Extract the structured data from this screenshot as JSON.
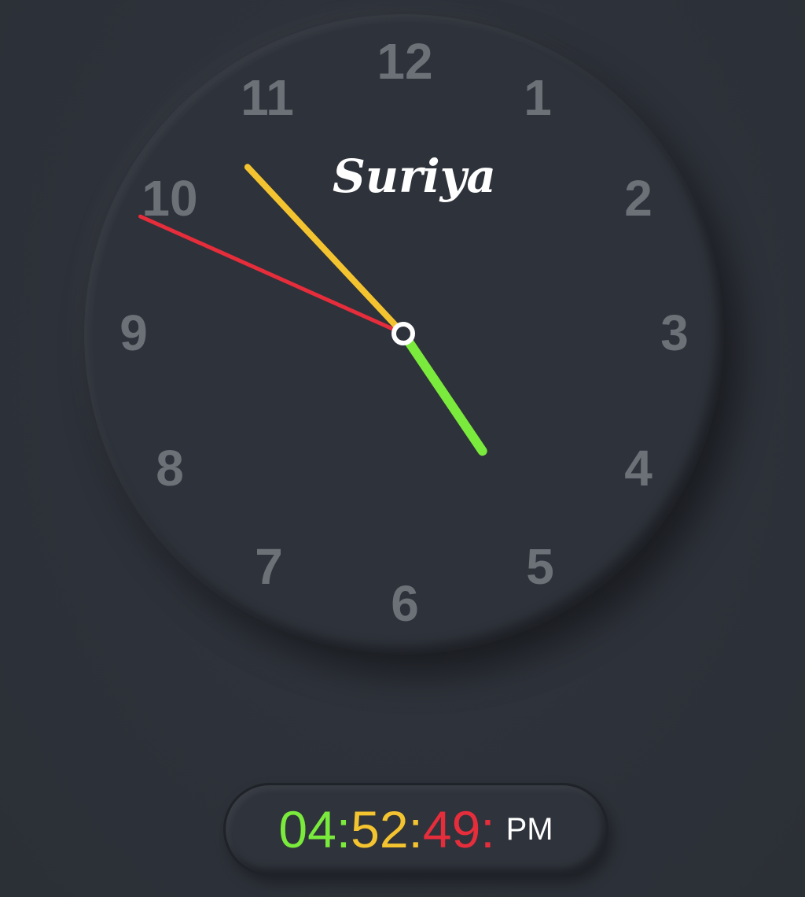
{
  "clock": {
    "brand": "Suriya",
    "numerals": [
      "12",
      "1",
      "2",
      "3",
      "4",
      "5",
      "6",
      "7",
      "8",
      "9",
      "10",
      "11"
    ],
    "time": {
      "hours": 4,
      "minutes": 52,
      "seconds": 49
    },
    "colors": {
      "hour_hand": "#7aea3c",
      "minute_hand": "#f4c430",
      "second_hand": "#e62d3b",
      "numeral": "#6c7077",
      "center_ring": "#ffffff"
    }
  },
  "digital": {
    "hours": "04:",
    "minutes": "52:",
    "seconds": "49:",
    "ampm": "PM",
    "colors": {
      "hours": "#7aea3c",
      "minutes": "#f4c430",
      "seconds": "#e62d3b"
    }
  }
}
